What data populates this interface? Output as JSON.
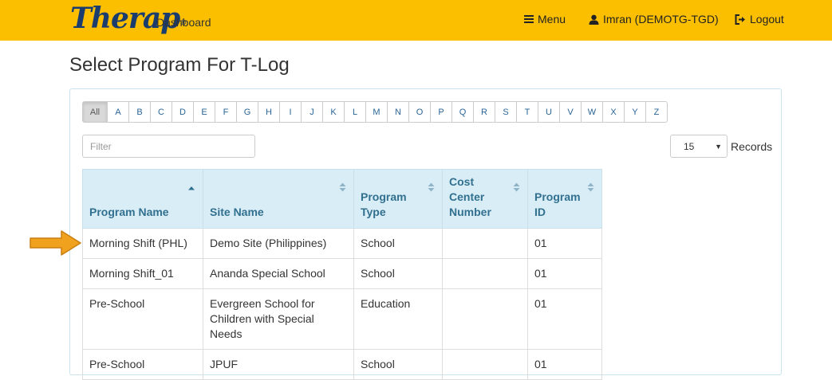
{
  "header": {
    "logo": "Therap",
    "logo_mark": "®",
    "dashboard": "Dashboard",
    "menu": "Menu",
    "user": "Imran (DEMOTG-TGD)",
    "logout": "Logout"
  },
  "page": {
    "title": "Select Program For T-Log"
  },
  "alphabet": [
    "All",
    "A",
    "B",
    "C",
    "D",
    "E",
    "F",
    "G",
    "H",
    "I",
    "J",
    "K",
    "L",
    "M",
    "N",
    "O",
    "P",
    "Q",
    "R",
    "S",
    "T",
    "U",
    "V",
    "W",
    "X",
    "Y",
    "Z"
  ],
  "filter": {
    "placeholder": "Filter",
    "value": ""
  },
  "records": {
    "selected": "15",
    "label": "Records"
  },
  "table": {
    "columns": [
      {
        "line1": "",
        "line2": "",
        "line3": "Program Name"
      },
      {
        "line1": "",
        "line2": "",
        "line3": "Site Name"
      },
      {
        "line1": "",
        "line2": "Program",
        "line3": "Type"
      },
      {
        "line1": "Cost",
        "line2": "Center",
        "line3": "Number"
      },
      {
        "line1": "",
        "line2": "Program",
        "line3": "ID"
      }
    ],
    "rows": [
      {
        "program_name": "Morning Shift (PHL)",
        "site_name": "Demo Site (Philippines)",
        "program_type": "School",
        "cost_center": "",
        "program_id": "01"
      },
      {
        "program_name": "Morning Shift_01",
        "site_name": "Ananda Special School",
        "program_type": "School",
        "cost_center": "",
        "program_id": "01"
      },
      {
        "program_name": "Pre-School",
        "site_name": "Evergreen School for Children with Special Needs",
        "program_type": "Education",
        "cost_center": "",
        "program_id": "01"
      },
      {
        "program_name": "Pre-School",
        "site_name": "JPUF",
        "program_type": "School",
        "cost_center": "",
        "program_id": "01"
      }
    ]
  },
  "colors": {
    "header_bg": "#fcbf00",
    "table_header_bg": "#d9edf7",
    "table_header_text": "#31708f",
    "link": "#2a6496",
    "arrow": "#f0a11e"
  },
  "icons": {
    "menu": "hamburger-icon",
    "user": "user-icon",
    "logout": "logout-icon",
    "sort": "sort-icon",
    "pointer": "pointer-arrow-icon"
  }
}
